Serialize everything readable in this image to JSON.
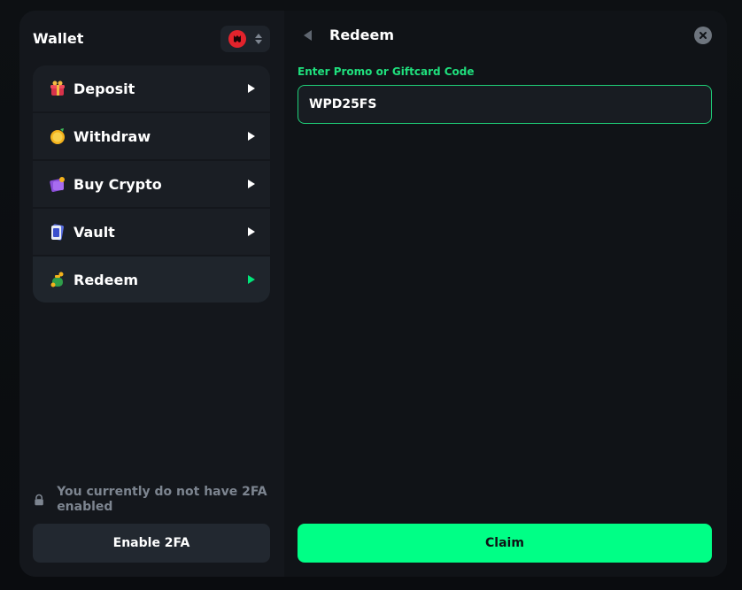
{
  "wallet": {
    "title": "Wallet",
    "currency_icon": "red-coin-icon"
  },
  "menu": {
    "items": [
      {
        "label": "Deposit",
        "icon": "gift-icon",
        "active": false
      },
      {
        "label": "Withdraw",
        "icon": "coin-icon",
        "active": false
      },
      {
        "label": "Buy Crypto",
        "icon": "purple-wallet-icon",
        "active": false
      },
      {
        "label": "Vault",
        "icon": "vault-card-icon",
        "active": false
      },
      {
        "label": "Redeem",
        "icon": "money-bag-icon",
        "active": true
      }
    ]
  },
  "security": {
    "notice": "You currently do not have 2FA enabled",
    "enable_label": "Enable 2FA"
  },
  "redeem": {
    "title": "Redeem",
    "input_label": "Enter Promo or Giftcard Code",
    "input_value": "WPD25FS",
    "claim_label": "Claim"
  },
  "colors": {
    "accent": "#00ff86",
    "accent_text": "#1fe07d",
    "panel": "#14171c",
    "panel_right": "#101317",
    "danger": "#e3232c"
  }
}
